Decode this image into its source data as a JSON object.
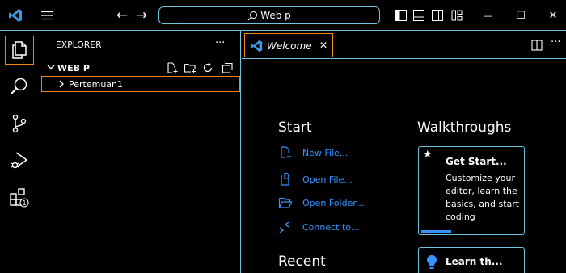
{
  "colors": {
    "background": "#000000",
    "border": "#6fc3df",
    "focus_border": "#f38518",
    "link": "#3794ff",
    "logo": "#3b9ae1"
  },
  "icons": {
    "app": "vscode-logo",
    "menu": "hamburger-menu",
    "back": "arrow-left",
    "forward": "arrow-right",
    "search": "magnifier",
    "explorer": "files",
    "scm": "source-control",
    "debug": "run-and-debug",
    "extensions": "extensions",
    "new_file": "new-file",
    "open_file": "open-file",
    "open_folder": "open-folder",
    "connect": "remote",
    "walkthrough": "star",
    "learn": "lightbulb"
  },
  "titlebar": {
    "back_glyph": "←",
    "forward_glyph": "→",
    "search_text": "Web p",
    "minimize_glyph": "—",
    "maximize_glyph": "☐",
    "close_glyph": "✕"
  },
  "activitybar": {
    "extensions_badge": "1"
  },
  "sidebar": {
    "title": "EXPLORER",
    "more_glyph": "···",
    "folder_name": "WEB P",
    "items": [
      {
        "label": "Pertemuan1"
      }
    ]
  },
  "editor": {
    "tabs": [
      {
        "label": "Welcome",
        "close_glyph": "✕"
      }
    ],
    "more_glyph": "···"
  },
  "welcome": {
    "start": {
      "heading": "Start",
      "links": [
        {
          "label": "New File..."
        },
        {
          "label": "Open File..."
        },
        {
          "label": "Open Folder..."
        },
        {
          "label": "Connect to..."
        }
      ]
    },
    "recent": {
      "heading": "Recent"
    },
    "walkthroughs": {
      "heading": "Walkthroughs",
      "cards": [
        {
          "star_glyph": "★",
          "title": "Get Start...",
          "description": "Customize your editor, learn the basics, and start coding",
          "progress": 0.3
        },
        {
          "title": "Learn th..."
        }
      ]
    }
  }
}
